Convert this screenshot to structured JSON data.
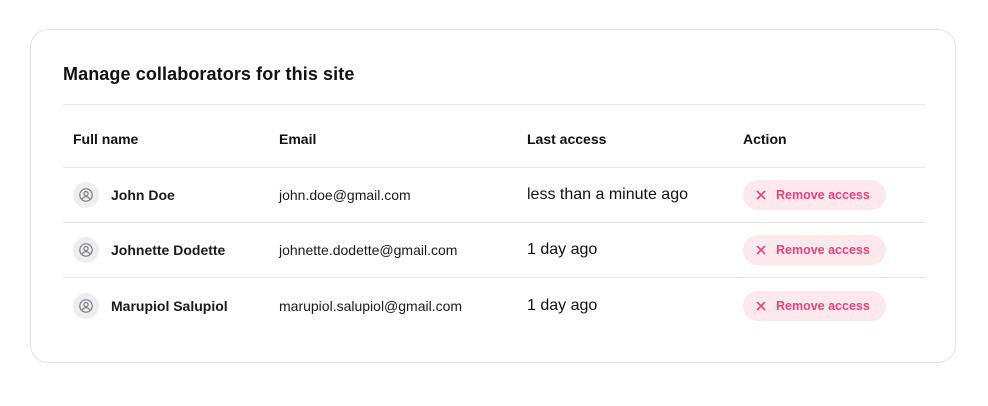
{
  "title": "Manage collaborators for this site",
  "columns": {
    "name": "Full name",
    "email": "Email",
    "last_access": "Last access",
    "action": "Action"
  },
  "rows": [
    {
      "name": "John Doe",
      "email": "john.doe@gmail.com",
      "last_access": "less than a minute ago",
      "action_label": "Remove access"
    },
    {
      "name": "Johnette Dodette",
      "email": "johnette.dodette@gmail.com",
      "last_access": "1 day ago",
      "action_label": "Remove access"
    },
    {
      "name": "Marupiol Salupiol",
      "email": "marupiol.salupiol@gmail.com",
      "last_access": "1 day ago",
      "action_label": "Remove access"
    }
  ],
  "icons": {
    "avatar": "user-circle-icon",
    "remove": "close-icon"
  },
  "colors": {
    "accent": "#e0447a",
    "accent_bg": "#fde8ee",
    "avatar_bg": "#eeeef0",
    "divider": "#e6e6e8"
  }
}
